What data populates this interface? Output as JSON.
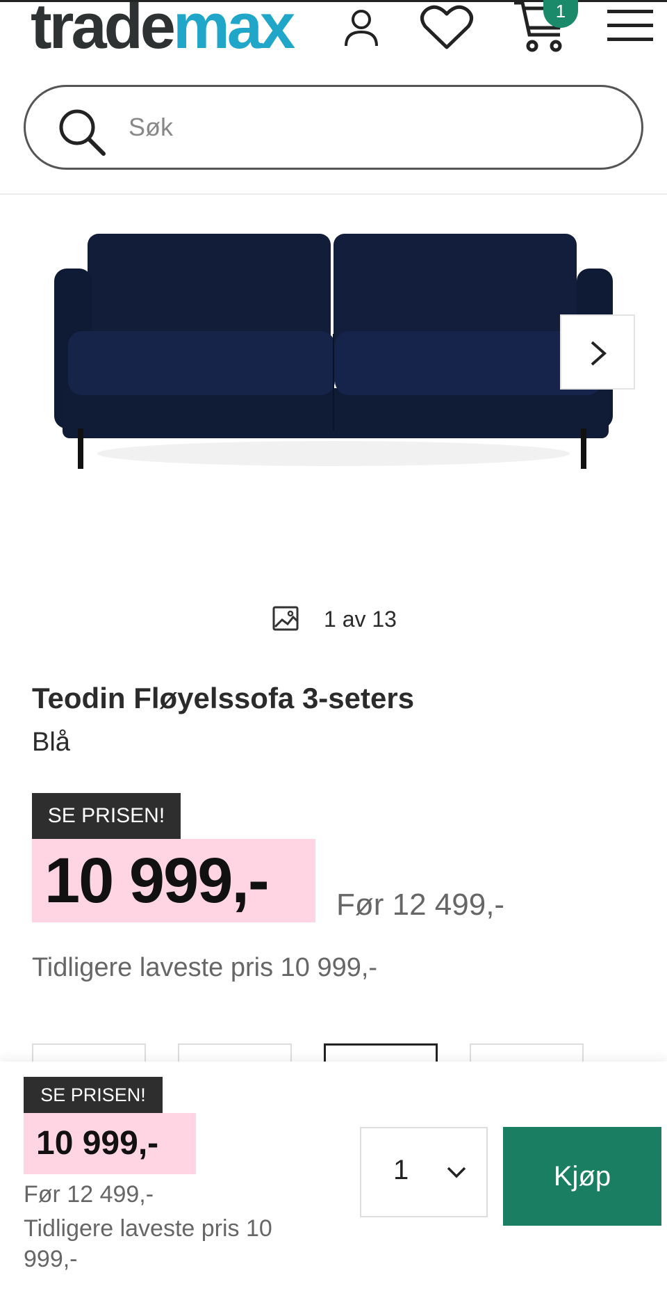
{
  "header": {
    "logo_part1": "trade",
    "logo_part2": "max",
    "cart_count": "1",
    "icons": [
      "user-icon",
      "heart-icon",
      "cart-icon",
      "menu-icon"
    ],
    "brand_color": "#1fa6c9"
  },
  "search": {
    "placeholder": "Søk"
  },
  "gallery": {
    "counter": "1 av 13",
    "next_icon": "chevron-right-icon"
  },
  "product": {
    "title": "Teodin Fløyelssofa 3-seters",
    "color": "Blå",
    "badge": "SE PRISEN!",
    "price": "10 999,-",
    "before_price": "Før 12 499,-",
    "lowest_price": "Tidligere laveste pris 10 999,-"
  },
  "sticky": {
    "badge": "SE PRISEN!",
    "price": "10 999,-",
    "before_price": "Før 12 499,-",
    "lowest_price": "Tidligere laveste pris 10 999,-",
    "quantity": "1",
    "buy_label": "Kjøp",
    "buy_color": "#1a7f62"
  }
}
